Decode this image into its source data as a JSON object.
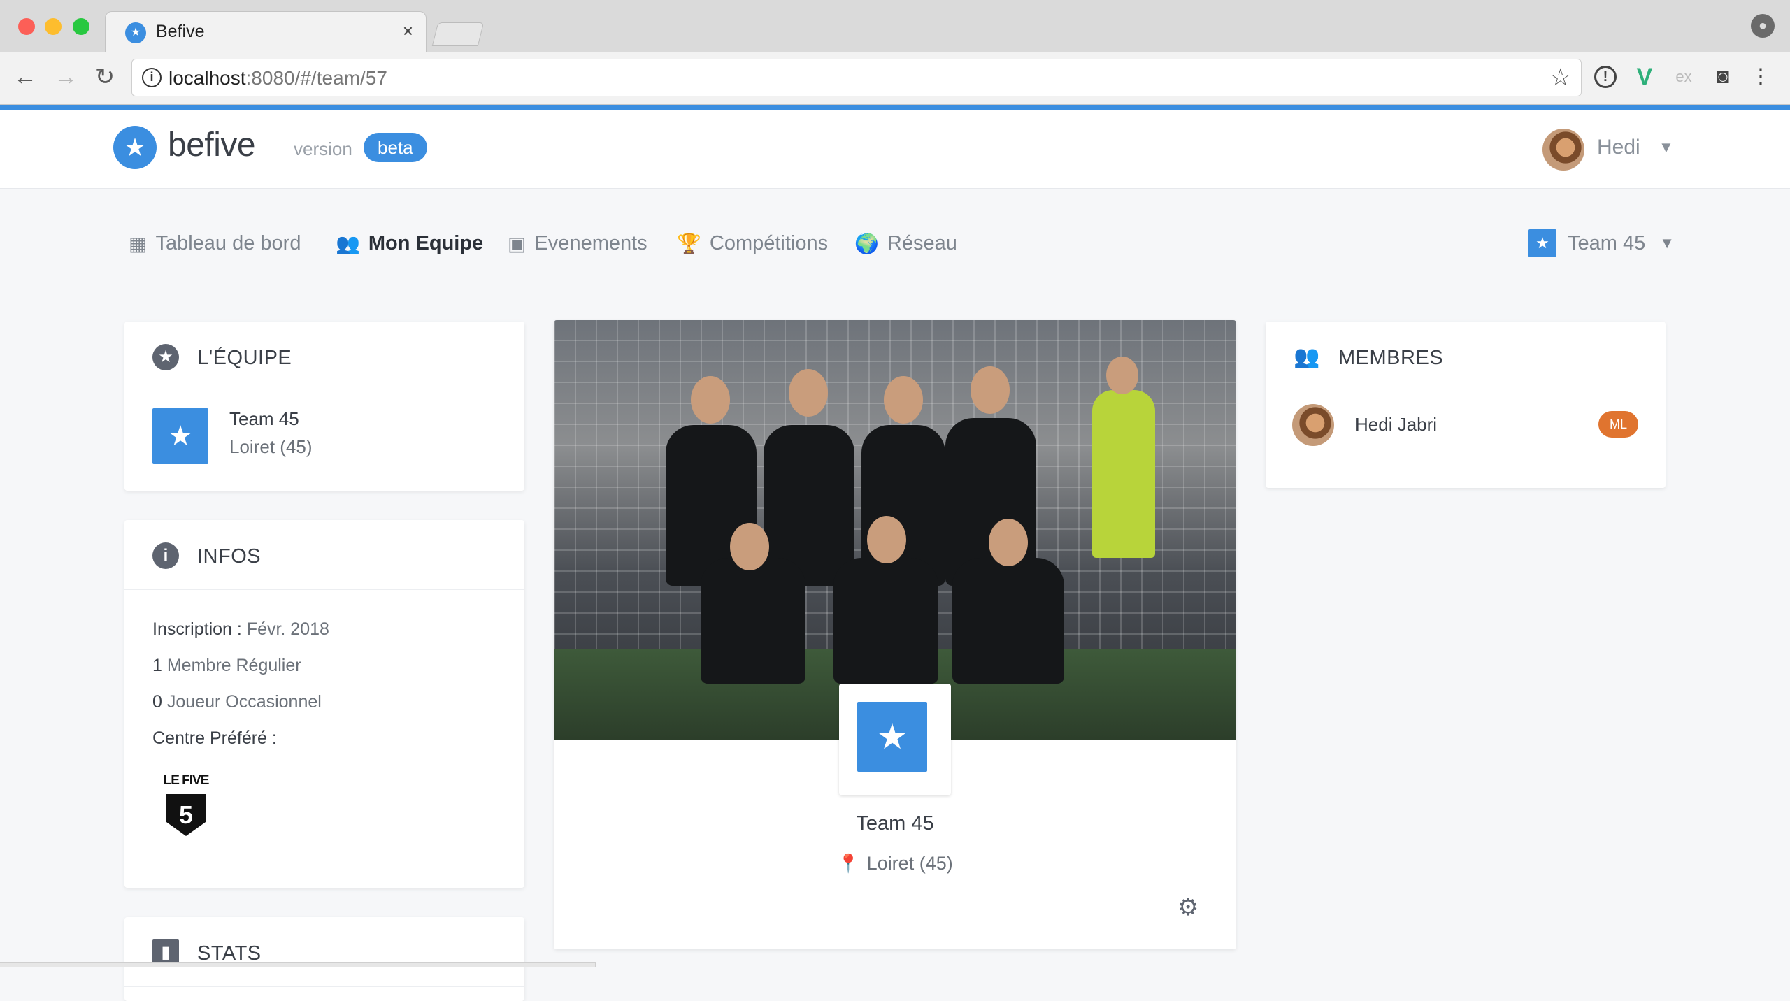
{
  "browser": {
    "tab_title": "Befive",
    "url_host": "localhost",
    "url_rest": ":8080/#/team/57"
  },
  "header": {
    "logo_text": "befive",
    "version_label": "version",
    "beta_badge": "beta",
    "user_name": "Hedi"
  },
  "nav": {
    "items": [
      {
        "label": "Tableau de bord",
        "icon": "dashboard-icon"
      },
      {
        "label": "Mon Equipe",
        "icon": "group-icon",
        "active": true
      },
      {
        "label": "Evenements",
        "icon": "calendar-icon"
      },
      {
        "label": "Compétitions",
        "icon": "trophy-icon"
      },
      {
        "label": "Réseau",
        "icon": "globe-icon"
      }
    ],
    "team_select": "Team 45"
  },
  "equipe": {
    "title": "L'ÉQUIPE",
    "team_name": "Team 45",
    "region": "Loiret (45)"
  },
  "infos": {
    "title": "INFOS",
    "inscription_label": "Inscription :",
    "inscription_value": "Févr. 2018",
    "membre_count": "1",
    "membre_label": "Membre Régulier",
    "joueur_count": "0",
    "joueur_label": "Joueur Occasionnel",
    "centre_label": "Centre Préféré :",
    "centre_logo_text": "LE FIVE",
    "centre_logo_number": "5"
  },
  "stats": {
    "title": "STATS"
  },
  "team_card": {
    "name": "Team 45",
    "location": "Loiret (45)"
  },
  "membres": {
    "title": "MEMBRES",
    "list": [
      {
        "name": "Hedi Jabri",
        "badge": "ML"
      }
    ]
  },
  "colors": {
    "accent": "#3b8ee0",
    "badge_orange": "#e0742f"
  }
}
